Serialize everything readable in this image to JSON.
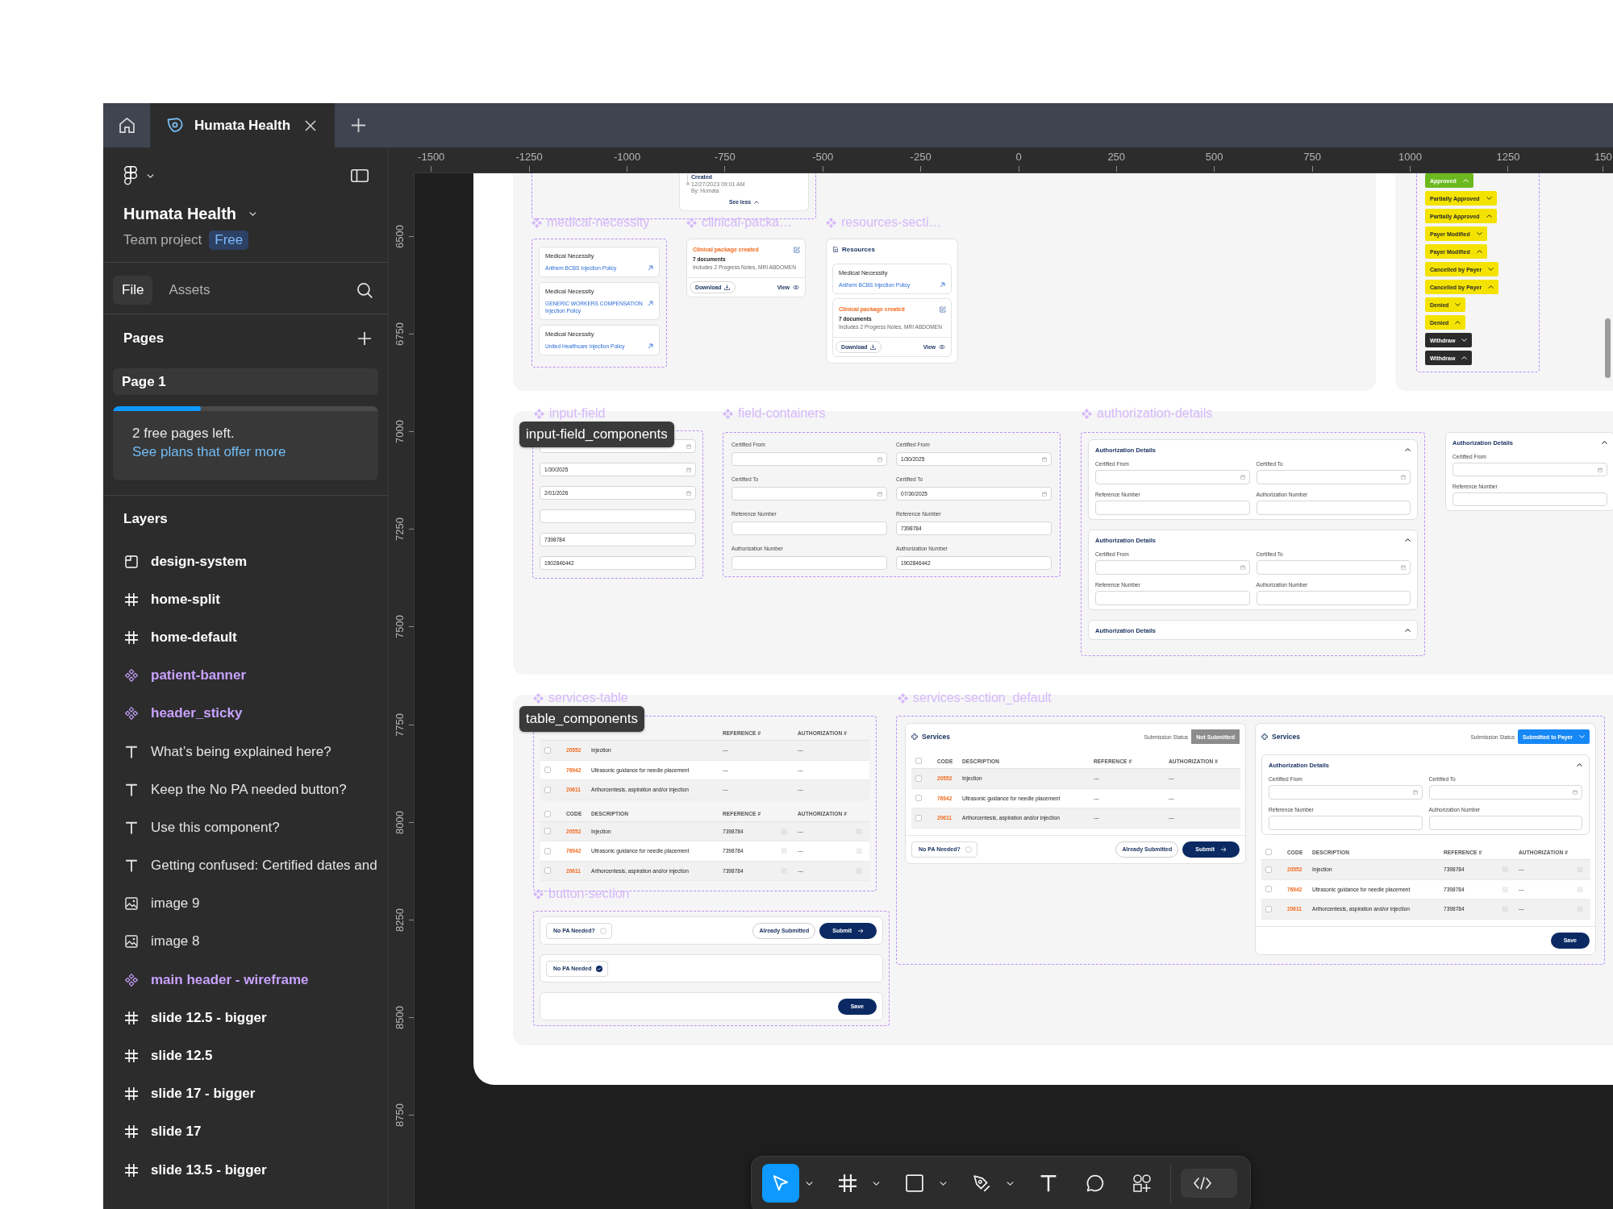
{
  "tab_bar": {
    "tabs": [
      {
        "label": "Humata Health",
        "selected": true
      }
    ]
  },
  "sidebar": {
    "file_name": "Humata Health",
    "project": "Team project",
    "plan": "Free",
    "tabs": [
      {
        "label": "File",
        "selected": true
      },
      {
        "label": "Assets",
        "selected": false
      }
    ],
    "pages_title": "Pages",
    "pages": [
      {
        "label": "Page 1",
        "selected": true
      }
    ],
    "upsell": {
      "level": 0.33,
      "text": "2 free pages left.",
      "link": "See plans that offer more"
    },
    "layers_title": "Layers",
    "layers": [
      {
        "kind": "section",
        "label": "design-system"
      },
      {
        "kind": "frame",
        "label": "home-split"
      },
      {
        "kind": "frame",
        "label": "home-default"
      },
      {
        "kind": "component",
        "label": "patient-banner"
      },
      {
        "kind": "component",
        "label": "header_sticky"
      },
      {
        "kind": "text",
        "label": "What’s being explained here?"
      },
      {
        "kind": "text",
        "label": "Keep the No PA needed button?"
      },
      {
        "kind": "text",
        "label": "Use this component?"
      },
      {
        "kind": "text",
        "label": "Getting confused: Certified dates and"
      },
      {
        "kind": "image",
        "label": "image 9"
      },
      {
        "kind": "image",
        "label": "image 8"
      },
      {
        "kind": "component",
        "label": "main header - wireframe"
      },
      {
        "kind": "frame",
        "label": "slide 12.5 - bigger"
      },
      {
        "kind": "frame",
        "label": "slide 12.5"
      },
      {
        "kind": "frame",
        "label": "slide 17 - bigger"
      },
      {
        "kind": "frame",
        "label": "slide 17"
      },
      {
        "kind": "frame",
        "label": "slide 13.5 - bigger"
      }
    ]
  },
  "rulers": {
    "horizontal": [
      "-1500",
      "-1250",
      "-1000",
      "-750",
      "-500",
      "-250",
      "0",
      "250",
      "500",
      "750",
      "1000",
      "1250",
      "150"
    ],
    "vertical": [
      "6500",
      "6750",
      "7000",
      "7250",
      "7500",
      "7750",
      "8000",
      "8250",
      "8500",
      "8750"
    ]
  },
  "canvas": {
    "timeline": {
      "event": "Created",
      "time": "12/27/2023 09:01 AM",
      "author": "By: Humata",
      "toggle": "See less"
    },
    "medical_necessity": {
      "label": "medical-necessity",
      "cards": [
        {
          "title": "Medical Necessity",
          "link": "Anthem BCBS Injection Policy"
        },
        {
          "title": "Medical Necessity",
          "link": "GENERIC WORKERS COMPENSATION Injection Policy"
        },
        {
          "title": "Medical Necessity",
          "link": "United Healthcare Injection Policy"
        }
      ]
    },
    "clinical_package": {
      "label": "clinical-packa…",
      "title": "Clinical package created",
      "count": "7 documents",
      "detail": "Includes 2 Progress Notes, MRI ABDOMEN",
      "download": "Download",
      "view": "View"
    },
    "resources": {
      "label": "resources-secti…",
      "title": "Resources",
      "items": [
        {
          "kind": "policy",
          "title": "Medical Necessity",
          "link": "Anthem BCBS Injection Policy"
        },
        {
          "kind": "package",
          "title": "Clinical package created",
          "count": "7 documents",
          "detail": "Includes 2 Progress Notes, MRI ABDOMEN",
          "download": "Download",
          "view": "View"
        }
      ]
    },
    "statuses": [
      {
        "label": "Approved",
        "color": "#6cb91f",
        "expanded": true
      },
      {
        "label": "Partially Approved",
        "color": "#f4e300",
        "expanded": false
      },
      {
        "label": "Partially Approved",
        "color": "#f4e300",
        "expanded": true
      },
      {
        "label": "Payer Modified",
        "color": "#f4e300",
        "expanded": false
      },
      {
        "label": "Payer Modified",
        "color": "#f4e300",
        "expanded": true
      },
      {
        "label": "Cancelled by Payer",
        "color": "#f4e300",
        "expanded": false
      },
      {
        "label": "Cancelled by Payer",
        "color": "#f4e300",
        "expanded": true
      },
      {
        "label": "Denied",
        "color": "#f4e300",
        "expanded": false
      },
      {
        "label": "Denied",
        "color": "#f4e300",
        "expanded": true
      },
      {
        "label": "Withdraw",
        "color": "#2b2b2b",
        "expanded": false
      },
      {
        "label": "Withdraw",
        "color": "#2b2b2b",
        "expanded": true
      }
    ],
    "input_field": {
      "label": "input-field",
      "tooltip": "input-field_components",
      "fields": [
        {
          "kind": "date"
        },
        {
          "kind": "date",
          "value": "1/30/2025"
        },
        {
          "kind": "date",
          "value": "2/01/2026"
        },
        {
          "kind": "text"
        },
        {
          "kind": "text",
          "value": "7398784"
        },
        {
          "kind": "text",
          "value": "1902846442"
        }
      ]
    },
    "field_containers": {
      "label": "field-containers",
      "columns": [
        {
          "fields": [
            {
              "label": "Certified From",
              "kind": "date"
            },
            {
              "label": "Certified To",
              "kind": "date"
            },
            {
              "label": "Reference Number",
              "kind": "text"
            },
            {
              "label": "Authorization Number",
              "kind": "text"
            }
          ]
        },
        {
          "fields": [
            {
              "label": "Certified From",
              "kind": "date",
              "value": "1/30/2025"
            },
            {
              "label": "Certified To",
              "kind": "date",
              "value": "07/30/2025"
            },
            {
              "label": "Reference Number",
              "kind": "text",
              "value": "7398784"
            },
            {
              "label": "Authorization Number",
              "kind": "text",
              "value": "1902846442"
            }
          ]
        }
      ]
    },
    "authorization_details": {
      "label": "authorization-details",
      "cards": [
        {
          "title": "Authorization Details",
          "fields": [
            {
              "label": "Certified From",
              "kind": "date"
            },
            {
              "label": "Certified To",
              "kind": "date"
            },
            {
              "label": "Reference Number",
              "kind": "text"
            },
            {
              "label": "Authorization Number",
              "kind": "text"
            }
          ]
        },
        {
          "title": "Authorization Details",
          "fields": [
            {
              "label": "Certified From",
              "kind": "date"
            },
            {
              "label": "Certified To",
              "kind": "date"
            },
            {
              "label": "Reference Number",
              "kind": "text"
            },
            {
              "label": "Authorization Number",
              "kind": "text"
            }
          ]
        },
        {
          "title": "Authorization Details"
        }
      ]
    },
    "authorization_preview": {
      "title": "Authorization Details",
      "fields": [
        {
          "label": "Certified From",
          "kind": "date"
        },
        {
          "label": "Reference Number",
          "kind": "text"
        }
      ]
    },
    "services_table": {
      "label": "services-table",
      "tooltip": "table_components",
      "tables": [
        {
          "editable": false,
          "header": {
            "reference": "REFERENCE #",
            "authorization": "AUTHORIZATION #"
          },
          "rows": [
            {
              "checked": false,
              "code": "20552",
              "description": "Injection",
              "reference": "---",
              "authorization": "---"
            },
            {
              "checked": false,
              "code": "76942",
              "description": "Ultrasonic guidance for needle placement",
              "reference": "---",
              "authorization": "---"
            },
            {
              "checked": false,
              "code": "20611",
              "description": "Arthorcentesis, aspiration and/or injection",
              "reference": "---",
              "authorization": "---"
            }
          ]
        },
        {
          "editable": true,
          "header": {
            "checked": false,
            "code": "CODE",
            "description": "DESCRIPTION",
            "reference": "REFERENCE #",
            "authorization": "AUTHORIZATION #"
          },
          "rows": [
            {
              "checked": false,
              "code": "20552",
              "description": "Injection",
              "reference": "7398784",
              "authorization": "---"
            },
            {
              "checked": false,
              "code": "76942",
              "description": "Ultrasonic guidance for needle placement",
              "reference": "7398784",
              "authorization": "---"
            },
            {
              "checked": false,
              "code": "20611",
              "description": "Arthorcentesis, aspiration and/or injection",
              "reference": "7398784",
              "authorization": "---"
            }
          ]
        }
      ]
    },
    "button_section": {
      "label": "button-section",
      "bars": [
        {
          "no_pa": {
            "label": "No PA Needed?",
            "checked": false
          },
          "secondary": "Already Submitted",
          "primary": {
            "kind": "submit",
            "label": "Submit"
          }
        },
        {
          "no_pa": {
            "label": "No PA Needed",
            "checked": true
          }
        },
        {
          "primary": {
            "kind": "save",
            "label": "Save"
          }
        }
      ]
    },
    "services_section": {
      "label": "services-section_default",
      "cards": [
        {
          "title": "Services",
          "status_caption": "Submission Status",
          "status": {
            "kind": "badge",
            "label": "Not Submitted"
          },
          "table": {
            "editable": false,
            "header": {
              "checked": false,
              "code": "CODE",
              "description": "DESCRIPTION",
              "reference": "REFERENCE #",
              "authorization": "AUTHORIZATION #"
            },
            "rows": [
              {
                "checked": false,
                "code": "20552",
                "description": "Injection",
                "reference": "---",
                "authorization": "---"
              },
              {
                "checked": false,
                "code": "76942",
                "description": "Ultrasonic guidance for needle placement",
                "reference": "---",
                "authorization": "---"
              },
              {
                "checked": false,
                "code": "20611",
                "description": "Arthorcentesis, aspiration and/or injection",
                "reference": "---",
                "authorization": "---"
              }
            ]
          },
          "footer": {
            "no_pa": {
              "label": "No PA Needed?",
              "checked": false
            },
            "secondary": "Already Submitted",
            "primary": {
              "kind": "submit",
              "label": "Submit"
            }
          }
        },
        {
          "title": "Services",
          "status_caption": "Submission Status",
          "status": {
            "kind": "dropdown",
            "label": "Submitted to Payer"
          },
          "authorization": {
            "title": "Authorization Details",
            "fields": [
              {
                "label": "Certified From",
                "kind": "date"
              },
              {
                "label": "Certified To",
                "kind": "date"
              },
              {
                "label": "Reference Number",
                "kind": "text"
              },
              {
                "label": "Authorization Number",
                "kind": "text"
              }
            ]
          },
          "table": {
            "editable": true,
            "header": {
              "checked": false,
              "code": "CODE",
              "description": "DESCRIPTION",
              "reference": "REFERENCE #",
              "authorization": "AUTHORIZATION #"
            },
            "rows": [
              {
                "checked": false,
                "code": "20552",
                "description": "Injection",
                "reference": "7398784",
                "authorization": "---"
              },
              {
                "checked": false,
                "code": "76942",
                "description": "Ultrasonic guidance for needle placement",
                "reference": "7398784",
                "authorization": "---"
              },
              {
                "checked": false,
                "code": "20611",
                "description": "Arthorcentesis, aspiration and/or injection",
                "reference": "7398784",
                "authorization": "---"
              }
            ]
          },
          "footer": {
            "primary": {
              "kind": "save",
              "label": "Save"
            }
          }
        }
      ]
    }
  },
  "toolbar": {
    "tools": [
      {
        "kind": "move",
        "selected": true,
        "menu": true
      },
      {
        "kind": "frame",
        "selected": false,
        "menu": true
      },
      {
        "kind": "shape",
        "selected": false,
        "menu": true
      },
      {
        "kind": "pen",
        "selected": false,
        "menu": true
      },
      {
        "kind": "text",
        "selected": false,
        "menu": false
      },
      {
        "kind": "comment",
        "selected": false,
        "menu": false
      },
      {
        "kind": "actions",
        "selected": false,
        "menu": false
      }
    ],
    "dev_mode": {
      "on": false
    }
  }
}
